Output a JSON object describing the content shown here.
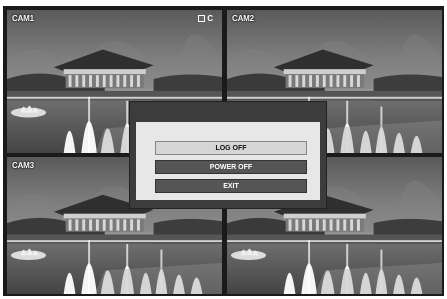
{
  "cameras": [
    {
      "label": "CAM1",
      "recording_status": "C"
    },
    {
      "label": "CAM2"
    },
    {
      "label": "CAM3"
    },
    {
      "label": ""
    }
  ],
  "menu": {
    "items": [
      {
        "label": "LOG OFF",
        "selected": true
      },
      {
        "label": "POWER OFF",
        "selected": false
      },
      {
        "label": "EXIT",
        "selected": false
      }
    ]
  },
  "colors": {
    "dialog_bg": "#3c3c3c",
    "dialog_body": "#e7e7e7",
    "button_selected": "#d5d5d5",
    "button_normal": "#555555"
  }
}
